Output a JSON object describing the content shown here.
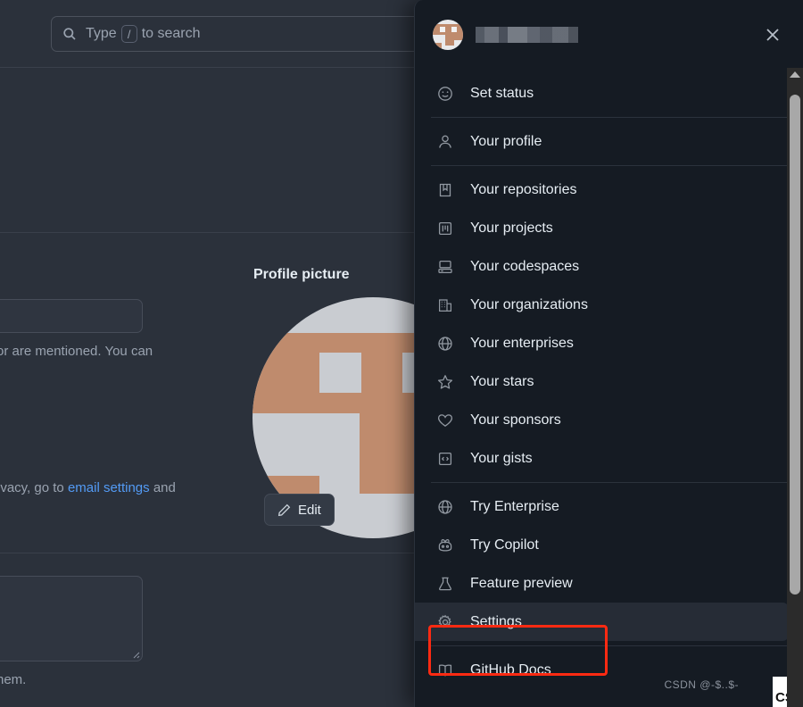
{
  "background_page": {
    "search": {
      "placeholder_prefix": "Type",
      "placeholder_key": "/",
      "placeholder_suffix": "to search",
      "icon": "search-icon"
    },
    "profile_picture_heading": "Profile picture",
    "edit_button": {
      "label": "Edit",
      "icon": "pencil-icon"
    },
    "text_fragments": [
      {
        "id": "mentioned",
        "text": "or are mentioned. You can"
      },
      {
        "id": "privacy_pre",
        "text": "rivacy, go to"
      },
      {
        "id": "privacy_link",
        "text": "email settings"
      },
      {
        "id": "privacy_post",
        "text": "and"
      },
      {
        "id": "them",
        "text": "hem."
      }
    ]
  },
  "user_menu": {
    "username_redacted": true,
    "avatar": "user-avatar",
    "close_label": "Close",
    "groups": [
      {
        "id": "status",
        "items": [
          {
            "label": "Set status",
            "icon": "smiley-icon"
          }
        ]
      },
      {
        "id": "profile",
        "items": [
          {
            "label": "Your profile",
            "icon": "person-icon"
          }
        ]
      },
      {
        "id": "resources",
        "items": [
          {
            "label": "Your repositories",
            "icon": "repo-icon"
          },
          {
            "label": "Your projects",
            "icon": "project-icon"
          },
          {
            "label": "Your codespaces",
            "icon": "codespaces-icon"
          },
          {
            "label": "Your organizations",
            "icon": "organization-icon"
          },
          {
            "label": "Your enterprises",
            "icon": "globe-icon"
          },
          {
            "label": "Your stars",
            "icon": "star-icon"
          },
          {
            "label": "Your sponsors",
            "icon": "heart-icon"
          },
          {
            "label": "Your gists",
            "icon": "code-square-icon"
          }
        ]
      },
      {
        "id": "try",
        "items": [
          {
            "label": "Try Enterprise",
            "icon": "globe-icon"
          },
          {
            "label": "Try Copilot",
            "icon": "copilot-icon"
          },
          {
            "label": "Feature preview",
            "icon": "beaker-icon"
          },
          {
            "label": "Settings",
            "icon": "gear-icon",
            "hovered": true
          }
        ]
      },
      {
        "id": "docs",
        "items": [
          {
            "label": "GitHub Docs",
            "icon": "book-icon"
          }
        ]
      }
    ]
  },
  "annotation": {
    "highlight_target": "Settings",
    "color": "#fe2a12"
  },
  "watermark": {
    "text": "CSDN @-$..$-",
    "logo_text": "CS"
  },
  "colors": {
    "panel_bg": "#151b23",
    "page_bg": "#2b313b",
    "hover_row": "#262c36",
    "link": "#539bf5",
    "text_primary": "#e6edf3",
    "text_muted": "#9aa3b0",
    "annotation": "#fe2a12",
    "avatar_accent": "#bf8b6d"
  }
}
